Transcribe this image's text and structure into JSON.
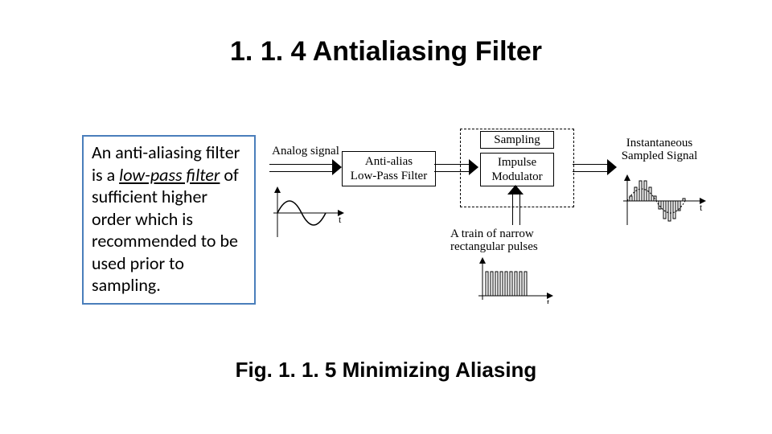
{
  "title": "1. 1. 4  Antialiasing Filter",
  "definition": {
    "pre": "An anti-aliasing filter is a ",
    "emph": "low-pass filter",
    "post": " of sufficient higher order which is recommended to be used prior to sampling."
  },
  "diagram": {
    "analog_signal": "Analog signal",
    "anti_alias_1": "Anti-alias",
    "anti_alias_2": "Low-Pass Filter",
    "sampling": "Sampling",
    "impulse_1": "Impulse",
    "impulse_2": "Modulator",
    "output_1": "Instantaneous",
    "output_2": "Sampled Signal",
    "pulses_1": "A train of narrow",
    "pulses_2": "rectangular pulses",
    "axis_t": "t"
  },
  "caption": "Fig. 1. 1. 5   Minimizing Aliasing"
}
